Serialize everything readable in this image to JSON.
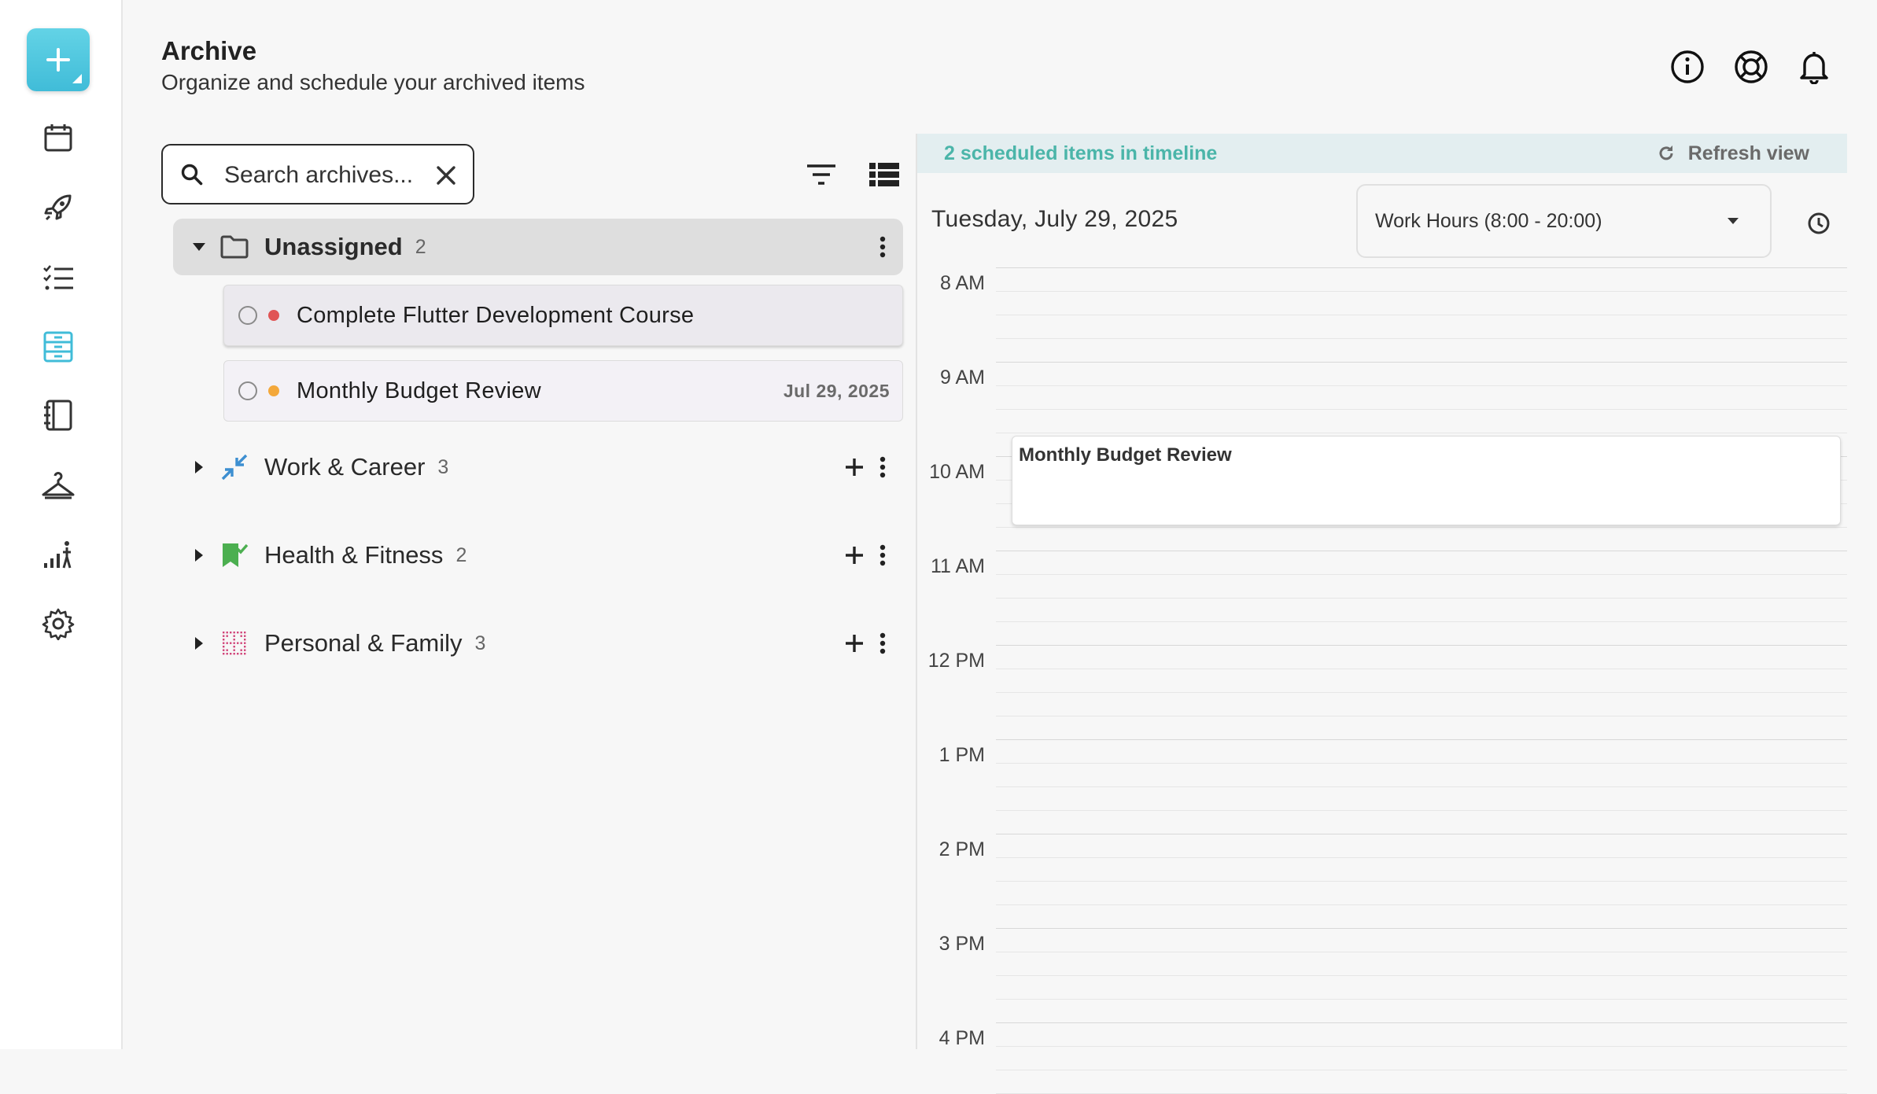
{
  "header": {
    "title": "Archive",
    "subtitle": "Organize and schedule your archived items",
    "icons": [
      "info-icon",
      "help-lifebuoy-icon",
      "bell-icon"
    ]
  },
  "sidebar": {
    "fab_icon": "plus-icon",
    "items": [
      {
        "icon": "calendar-icon",
        "active": false
      },
      {
        "icon": "rocket-icon",
        "active": false
      },
      {
        "icon": "checklist-icon",
        "active": false
      },
      {
        "icon": "archive-icon",
        "active": true
      },
      {
        "icon": "notebook-icon",
        "active": false
      },
      {
        "icon": "hanger-icon",
        "active": false
      },
      {
        "icon": "stats-icon",
        "active": false
      },
      {
        "icon": "settings-icon",
        "active": false
      }
    ]
  },
  "search": {
    "placeholder": "Search archives...",
    "value": ""
  },
  "groups": [
    {
      "name": "Unassigned",
      "count": "2",
      "expanded": true,
      "icon": "folder-icon",
      "tasks": [
        {
          "title": "Complete Flutter Development Course",
          "date": "",
          "dot_color": "#e05555"
        },
        {
          "title": "Monthly Budget Review",
          "date": "Jul 29, 2025",
          "dot_color": "#f3a83b"
        }
      ]
    },
    {
      "name": "Work & Career",
      "count": "3",
      "expanded": false,
      "icon": "compress-arrows-icon",
      "icon_color": "#3d8fd1"
    },
    {
      "name": "Health & Fitness",
      "count": "2",
      "expanded": false,
      "icon": "bookmark-check-icon",
      "icon_color": "#4caf50"
    },
    {
      "name": "Personal & Family",
      "count": "3",
      "expanded": false,
      "icon": "dot-grid-icon",
      "icon_color": "#d1457a"
    }
  ],
  "timeline": {
    "banner": "2 scheduled items in timeline",
    "refresh_label": "Refresh view",
    "date": "Tuesday, July 29, 2025",
    "range_selected": "Work Hours (8:00 - 20:00)",
    "hours": [
      "8 AM",
      "9 AM",
      "10 AM",
      "11 AM",
      "12 PM",
      "1 PM",
      "2 PM",
      "3 PM",
      "4 PM"
    ],
    "events": [
      {
        "title": "Monthly Budget Review"
      }
    ]
  },
  "colors": {
    "accent": "#40bcd8",
    "banner_text": "#4bb5a9"
  }
}
